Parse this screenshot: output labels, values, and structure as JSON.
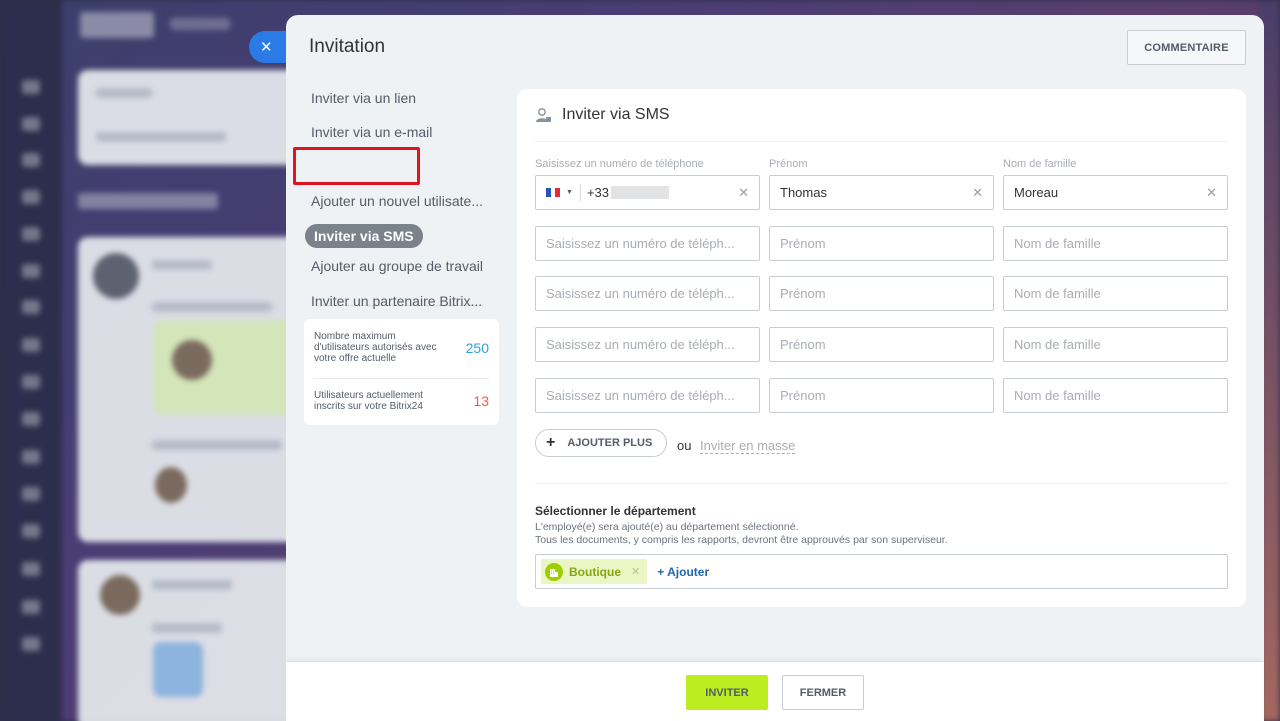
{
  "modal": {
    "close_glyph": "✕",
    "title": "Invitation",
    "comment_button": "COMMENTAIRE"
  },
  "menu": {
    "items": [
      {
        "label": "Inviter via un lien"
      },
      {
        "label": "Inviter via un e-mail"
      },
      {
        "label": "Inviter via SMS",
        "active": true
      },
      {
        "label": "Ajouter un nouvel utilisate..."
      },
      {
        "label": "Ajouter au groupe de travail"
      },
      {
        "label": "Inviter un partenaire Bitrix..."
      }
    ]
  },
  "limits": {
    "max_label": "Nombre maximum d'utilisateurs autorisés avec votre offre actuelle",
    "max_value": "250",
    "current_label": "Utilisateurs actuellement inscrits sur votre Bitrix24",
    "current_value": "13",
    "max_color": "#2fa3d5",
    "current_color": "#ef5b4f"
  },
  "form": {
    "heading": "Inviter via SMS",
    "heading_icon": "user-icon",
    "phone_label": "Saisissez un numéro de téléphone",
    "first_name_label": "Prénom",
    "last_name_label": "Nom de famille",
    "rows": [
      {
        "phone_prefix": "+33",
        "first_name": "Thomas",
        "last_name": "Moreau"
      }
    ],
    "phone_placeholder": "Saisissez un numéro de téléph...",
    "first_name_placeholder": "Prénom",
    "last_name_placeholder": "Nom de famille",
    "clear_glyph": "✕",
    "add_more": "AJOUTER PLUS",
    "or": "ou",
    "mass_invite": "Inviter en masse"
  },
  "department": {
    "title": "Sélectionner le département",
    "desc_line1": "L'employé(e) sera ajouté(e) au département sélectionné.",
    "desc_line2": "Tous les documents, y compris les rapports, devront être approuvés par son superviseur.",
    "tag": "Boutique",
    "add": "+ Ajouter"
  },
  "footer": {
    "invite": "INVITER",
    "close": "FERMER"
  },
  "colors": {
    "accent_blue": "#2b7be6",
    "invite_green": "#bbed21",
    "highlight_red": "#e0141e"
  }
}
